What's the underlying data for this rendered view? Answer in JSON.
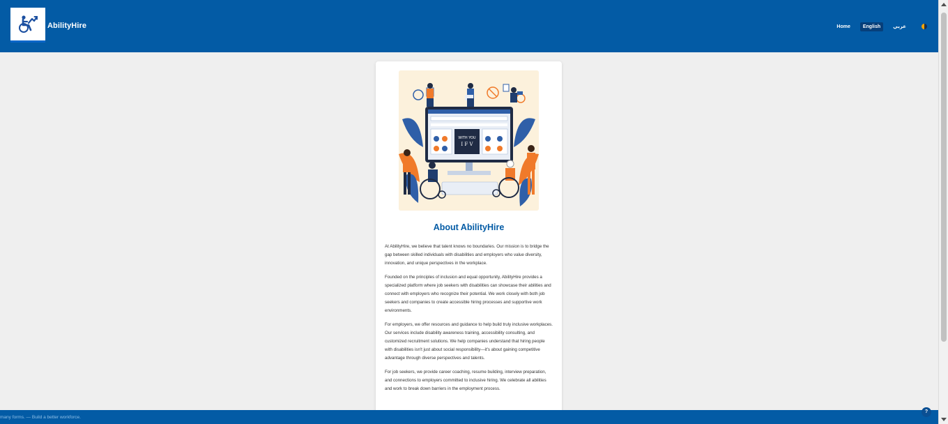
{
  "header": {
    "brand": "AbilityHire",
    "nav": {
      "home": "Home",
      "english": "English",
      "arabic": "عربي"
    }
  },
  "about": {
    "title": "About AbilityHire",
    "paragraphs": [
      "At AbilityHire, we believe that talent knows no boundaries. Our mission is to bridge the gap between skilled individuals with disabilities and employers who value diversity, innovation, and unique perspectives in the workplace.",
      "Founded on the principles of inclusion and equal opportunity, AbilityHire provides a specialized platform where job seekers with disabilities can showcase their abilities and connect with employers who recognize their potential. We work closely with both job seekers and companies to create accessible hiring processes and supportive work environments.",
      "For employers, we offer resources and guidance to help build truly inclusive workplaces. Our services include disability awareness training, accessibility consulting, and customized recruitment solutions. We help companies understand that hiring people with disabilities isn't just about social responsibility—it's about gaining competitive advantage through diverse perspectives and talents.",
      "For job seekers, we provide career coaching, resume building, interview preparation, and connections to employers committed to inclusive hiring. We celebrate all abilities and work to break down barriers in the employment process."
    ]
  },
  "footer": {
    "ticker": "many forms. — Build a better workforce."
  },
  "help_label": "?",
  "colors": {
    "primary": "#035ba5",
    "accent_orange": "#f07a2a",
    "background": "#efefef"
  },
  "icons": [
    "wheelchair-logo-icon",
    "theme-toggle-icon",
    "help-icon"
  ]
}
